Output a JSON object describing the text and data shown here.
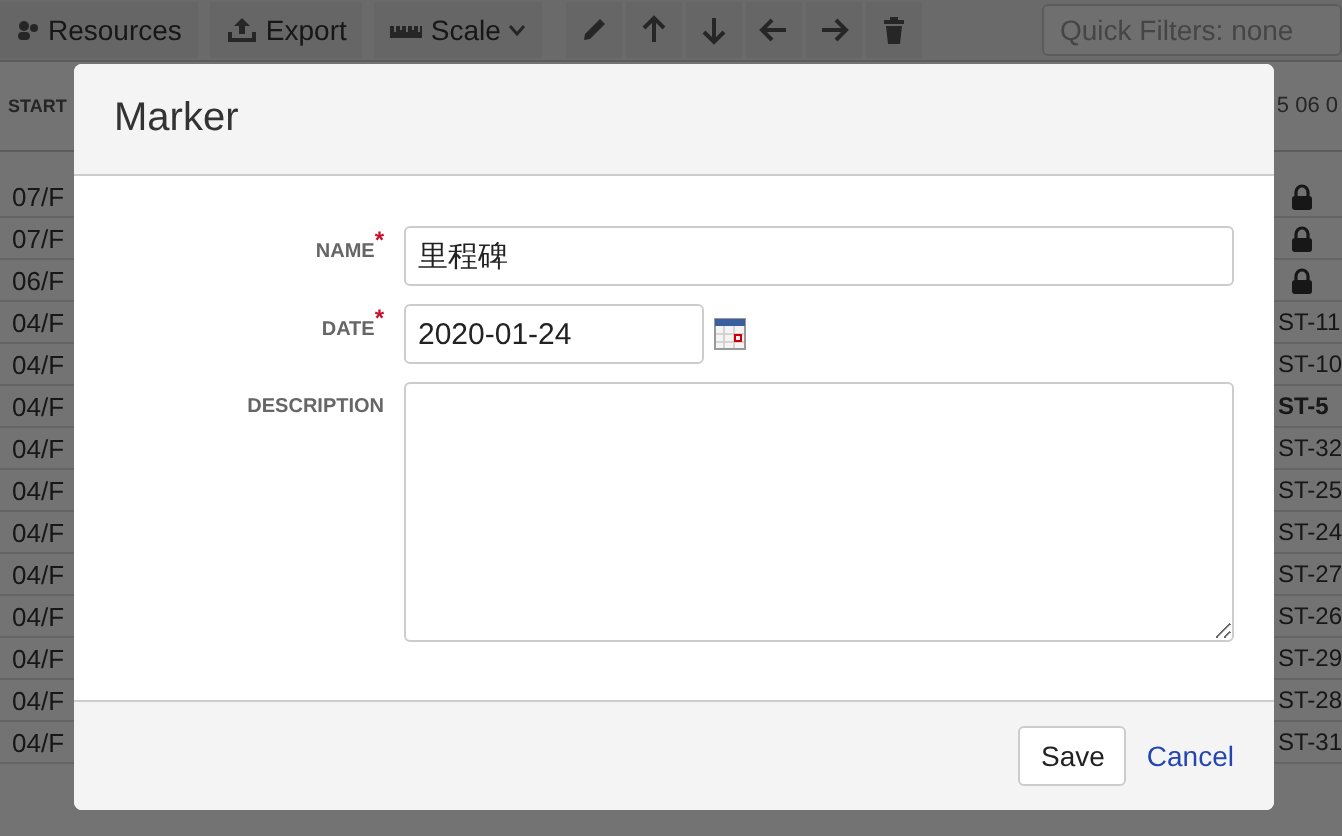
{
  "toolbar": {
    "buttons": [
      {
        "label": "Resources",
        "caret": false
      },
      {
        "label": "Export",
        "caret": false
      },
      {
        "label": "Scale",
        "caret": true
      }
    ],
    "quick_filter": {
      "placeholder": "Quick Filters: none"
    }
  },
  "grid": {
    "start_header": "START",
    "time_header": "5 06 0",
    "left_rows": [
      "07/F",
      "07/F",
      "06/F",
      "04/F",
      "04/F",
      "04/F",
      "04/F",
      "04/F",
      "04/F",
      "04/F",
      "04/F",
      "04/F",
      "04/F",
      "04/F"
    ],
    "right_rows": [
      {
        "kind": "lock"
      },
      {
        "kind": "lock"
      },
      {
        "kind": "lock"
      },
      {
        "kind": "id",
        "text": "ST-11",
        "emphasized": false
      },
      {
        "kind": "id",
        "text": "ST-10",
        "emphasized": false
      },
      {
        "kind": "id",
        "text": "ST-5",
        "emphasized": true
      },
      {
        "kind": "id",
        "text": "ST-32",
        "emphasized": false
      },
      {
        "kind": "id",
        "text": "ST-25",
        "emphasized": false
      },
      {
        "kind": "id",
        "text": "ST-24",
        "emphasized": false
      },
      {
        "kind": "id",
        "text": "ST-27",
        "emphasized": false
      },
      {
        "kind": "id",
        "text": "ST-26",
        "emphasized": false
      },
      {
        "kind": "id",
        "text": "ST-29",
        "emphasized": false
      },
      {
        "kind": "id",
        "text": "ST-28",
        "emphasized": false
      },
      {
        "kind": "id",
        "text": "ST-31",
        "emphasized": false
      }
    ]
  },
  "dialog": {
    "title": "Marker",
    "fields": [
      {
        "kind": "text",
        "label": "NAME",
        "required_mark": "*",
        "value": "里程碑"
      },
      {
        "kind": "date",
        "label": "DATE",
        "required_mark": "*",
        "value": "2020-01-24"
      },
      {
        "kind": "textarea",
        "label": "DESCRIPTION"
      }
    ],
    "save": "Save",
    "cancel": "Cancel"
  }
}
